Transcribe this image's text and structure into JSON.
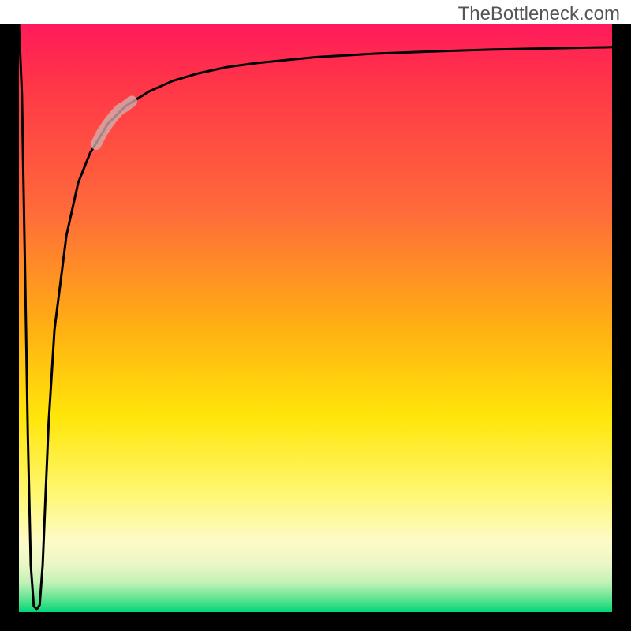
{
  "watermark": "TheBottleneck.com",
  "chart_data": {
    "type": "line",
    "title": "",
    "xlabel": "",
    "ylabel": "",
    "xlim": [
      0,
      100
    ],
    "ylim": [
      0,
      100
    ],
    "grid": false,
    "background": "rainbow-vertical-gradient",
    "series": [
      {
        "name": "bottleneck-curve",
        "x": [
          0.0,
          0.5,
          1.0,
          1.5,
          2.0,
          2.5,
          3.0,
          3.5,
          4.0,
          4.5,
          5.0,
          6.0,
          8.0,
          10.0,
          12.0,
          15.0,
          18.0,
          22.0,
          26.0,
          30.0,
          35.0,
          40.0,
          50.0,
          60.0,
          70.0,
          80.0,
          90.0,
          100.0
        ],
        "y": [
          100.0,
          88.0,
          60.0,
          30.0,
          8.0,
          1.0,
          0.5,
          1.2,
          8.0,
          20.0,
          32.0,
          48.0,
          64.0,
          73.0,
          78.0,
          83.0,
          86.0,
          88.5,
          90.3,
          91.5,
          92.6,
          93.3,
          94.3,
          94.9,
          95.3,
          95.6,
          95.8,
          96.0
        ]
      },
      {
        "name": "highlight-segment",
        "x": [
          13.0,
          14.0,
          15.0,
          16.0,
          17.0,
          18.0,
          19.0
        ],
        "y": [
          79.5,
          81.5,
          83.0,
          84.3,
          85.4,
          86.0,
          86.8
        ]
      }
    ],
    "colors": {
      "curve": "#000000",
      "highlight": "rgba(210,180,180,0.75)"
    }
  }
}
